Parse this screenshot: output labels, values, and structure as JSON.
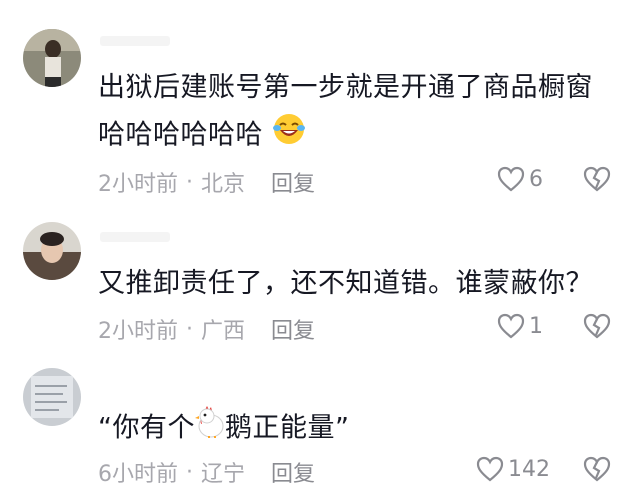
{
  "comments": [
    {
      "text_line1": "出狱后建账号第一步就是开通了商品橱窗",
      "text_line2": "哈哈哈哈哈哈",
      "emoji_icon": "laughing-tears-emoji",
      "time": "2小时前",
      "separator": "·",
      "location": "北京",
      "reply_label": "回复",
      "likes": "6"
    },
    {
      "text_line1": "又推卸责任了，还不知道错。谁蒙蔽你？",
      "time": "2小时前",
      "separator": "·",
      "location": "广西",
      "reply_label": "回复",
      "likes": "1"
    },
    {
      "text_before": "“你有个",
      "emoji_icon": "chicken-emoji",
      "text_after": "鹅正能量”",
      "time": "6小时前",
      "separator": "·",
      "location": "辽宁",
      "reply_label": "回复",
      "likes": "142"
    }
  ],
  "colors": {
    "text": "#161823",
    "meta": "#a7a7ad",
    "icon": "#8a8b91"
  }
}
